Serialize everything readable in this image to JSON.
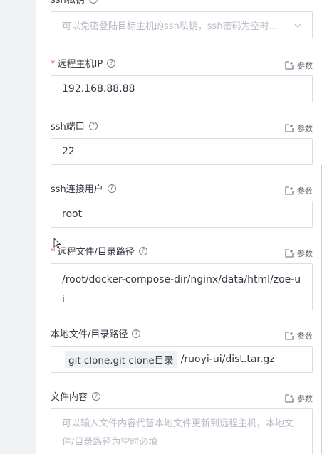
{
  "param_label": "参数",
  "fields": {
    "ssh_key": {
      "label": "ssh私钥",
      "placeholder": "可以免密登陆目标主机的ssh私钥，ssh密码为空时..."
    },
    "remote_ip": {
      "label": "远程主机IP",
      "value": "192.168.88.88"
    },
    "ssh_port": {
      "label": "ssh端口",
      "value": "22"
    },
    "ssh_user": {
      "label": "ssh连接用户",
      "value": "root"
    },
    "remote_path": {
      "label": "远程文件/目录路径",
      "value": "/root/docker-compose-dir/nginx/data/html/zoe-ui"
    },
    "local_path": {
      "label": "本地文件/目录路径",
      "tag": "git clone.git clone目录",
      "value": "/ruoyi-ui/dist.tar.gz"
    },
    "file_content": {
      "label": "文件内容",
      "placeholder": "可以输入文件内容代替本地文件更新到远程主机，本地文件/目录路径为空时必填"
    }
  }
}
